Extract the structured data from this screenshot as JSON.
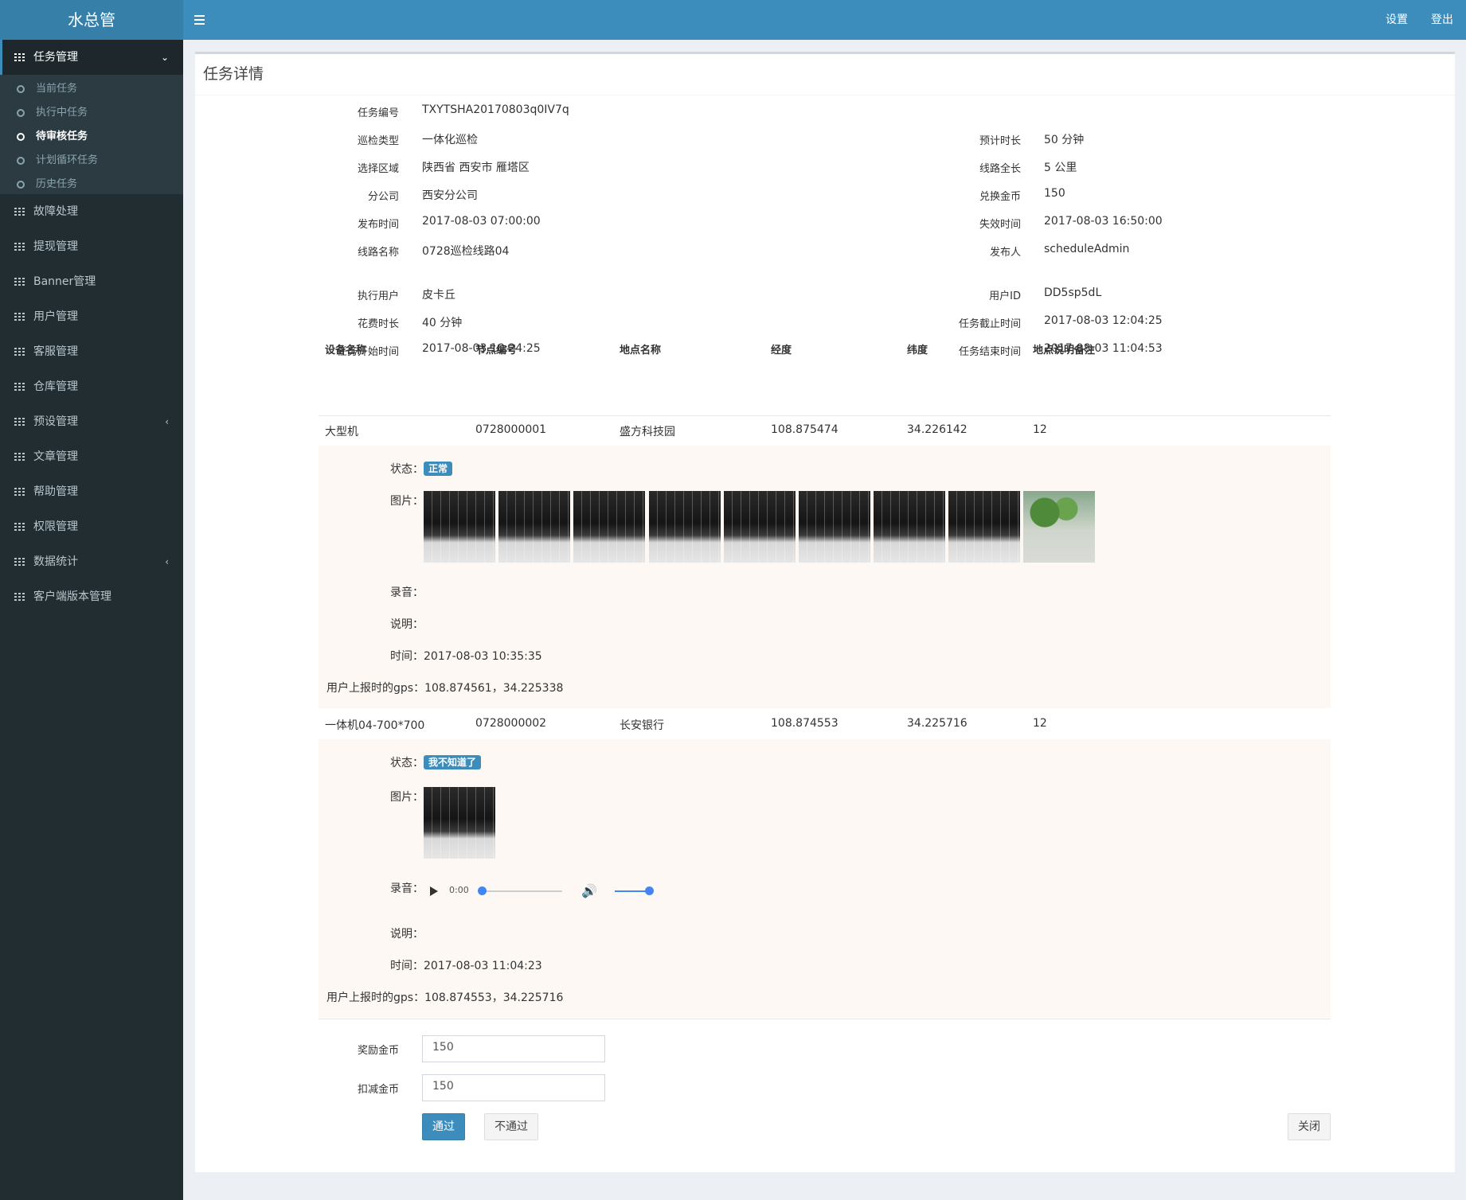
{
  "app": {
    "logo": "水总管",
    "settings": "设置",
    "logout": "登出"
  },
  "sidebar": {
    "active": {
      "label": "任务管理",
      "chevron": "⌄"
    },
    "sub": [
      "当前任务",
      "执行中任务",
      "待审核任务",
      "计划循环任务",
      "历史任务"
    ],
    "items": [
      {
        "label": "故障处理",
        "chevron": ""
      },
      {
        "label": "提现管理",
        "chevron": ""
      },
      {
        "label": "Banner管理",
        "chevron": ""
      },
      {
        "label": "用户管理",
        "chevron": ""
      },
      {
        "label": "客服管理",
        "chevron": ""
      },
      {
        "label": "仓库管理",
        "chevron": ""
      },
      {
        "label": "预设管理",
        "chevron": "‹"
      },
      {
        "label": "文章管理",
        "chevron": ""
      },
      {
        "label": "帮助管理",
        "chevron": ""
      },
      {
        "label": "权限管理",
        "chevron": ""
      },
      {
        "label": "数据统计",
        "chevron": "‹"
      },
      {
        "label": "客户端版本管理",
        "chevron": ""
      }
    ]
  },
  "page": {
    "title": "任务详情"
  },
  "info": {
    "task_no": {
      "label": "任务编号",
      "value": "TXYTSHA20170803q0IV7q"
    },
    "patrol_type": {
      "label": "巡检类型",
      "value": "一体化巡检"
    },
    "region": {
      "label": "选择区域",
      "value": "陕西省 西安市 雁塔区"
    },
    "branch": {
      "label": "分公司",
      "value": "西安分公司"
    },
    "publish_time": {
      "label": "发布时间",
      "value": "2017-08-03 07:00:00"
    },
    "route_name": {
      "label": "线路名称",
      "value": "0728巡检线路04"
    },
    "est_duration": {
      "label": "预计时长",
      "value": "50 分钟"
    },
    "route_length": {
      "label": "线路全长",
      "value": "5 公里"
    },
    "coins": {
      "label": "兑换金币",
      "value": "150"
    },
    "expire_time": {
      "label": "失效时间",
      "value": "2017-08-03 16:50:00"
    },
    "publisher": {
      "label": "发布人",
      "value": "scheduleAdmin"
    },
    "exec_user": {
      "label": "执行用户",
      "value": "皮卡丘"
    },
    "spent": {
      "label": "花费时长",
      "value": "40 分钟"
    },
    "start_time": {
      "label": "任务开始时间",
      "value": "2017-08-03 10:24:25"
    },
    "user_id": {
      "label": "用户ID",
      "value": "DD5sp5dL"
    },
    "deadline": {
      "label": "任务截止时间",
      "value": "2017-08-03 12:04:25"
    },
    "end_time": {
      "label": "任务结束时间",
      "value": "2017-08-03 11:04:53"
    }
  },
  "table": {
    "headers": [
      "设备名称",
      "节点编号",
      "地点名称",
      "经度",
      "纬度",
      "地点说明备注"
    ],
    "rows": [
      {
        "cells": [
          "大型机",
          "0728000001",
          "盛方科技园",
          "108.875474",
          "34.226142",
          "12"
        ],
        "status_label": "状态：",
        "status": "正常",
        "pic_label": "图片：",
        "audio_label": "录音：",
        "note_label": "说明：",
        "time_label": "时间：",
        "time": "2017-08-03 10:35:35",
        "gps_label": "用户上报时的gps：",
        "gps": "108.874561，34.225338"
      },
      {
        "cells": [
          "一体机04-700*700",
          "0728000002",
          "长安银行",
          "108.874553",
          "34.225716",
          "12"
        ],
        "status_label": "状态：",
        "status": "我不知道了",
        "pic_label": "图片：",
        "audio_label": "录音：",
        "audio_time": "0:00",
        "note_label": "说明：",
        "time_label": "时间：",
        "time": "2017-08-03 11:04:23",
        "gps_label": "用户上报时的gps：",
        "gps": "108.874553，34.225716"
      }
    ]
  },
  "form": {
    "reward": {
      "label": "奖励金币",
      "value": "150"
    },
    "deduct": {
      "label": "扣减金币",
      "value": "150"
    },
    "pass": "通过",
    "reject": "不通过",
    "close": "关闭"
  }
}
